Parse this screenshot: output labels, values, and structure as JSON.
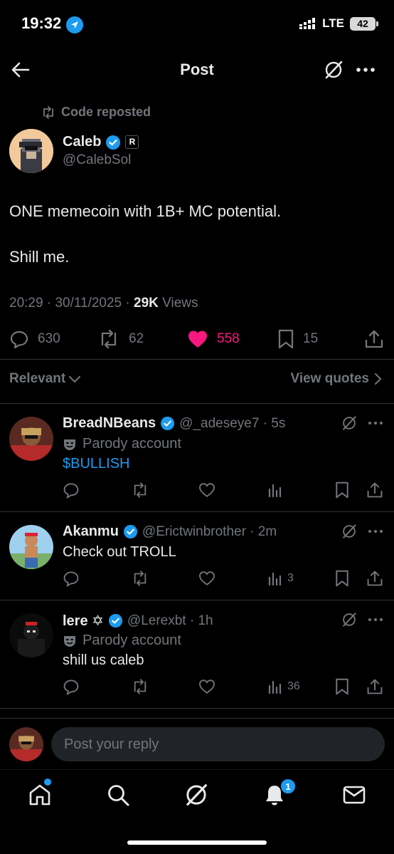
{
  "status_bar": {
    "time": "19:32",
    "network": "LTE",
    "battery": "42"
  },
  "header": {
    "title": "Post"
  },
  "post": {
    "repost_label": "Code reposted",
    "author_name": "Caleb",
    "author_handle": "@CalebSol",
    "affiliate_badge": "R",
    "text_line1": "ONE memecoin with 1B+ MC potential.",
    "text_line2": "Shill me.",
    "time": "20:29",
    "date": "30/11/2025",
    "views_count": "29K",
    "views_label": "Views",
    "replies": "630",
    "reposts": "62",
    "likes": "558",
    "bookmarks": "15",
    "like_color": "#f91880"
  },
  "sort": {
    "label": "Relevant",
    "view_quotes": "View quotes"
  },
  "replies": [
    {
      "name": "BreadNBeans",
      "handle": "@_adeseye7",
      "time": "5s",
      "parody_label": "Parody account",
      "text": "$BULLISH",
      "views": ""
    },
    {
      "name": "Akanmu",
      "handle": "@Erictwinbrother",
      "time": "2m",
      "parody_label": "",
      "text": "Check out TROLL",
      "views": "3"
    },
    {
      "name": "lere ✡",
      "handle": "@Lerexbt",
      "time": "1h",
      "parody_label": "Parody account",
      "text": "shill us caleb",
      "views": "36"
    }
  ],
  "composer": {
    "placeholder": "Post your reply"
  },
  "tabbar": {
    "notifications_badge": "1"
  },
  "colors": {
    "accent": "#1d9bf0",
    "background": "#000000",
    "muted": "#71767b"
  }
}
